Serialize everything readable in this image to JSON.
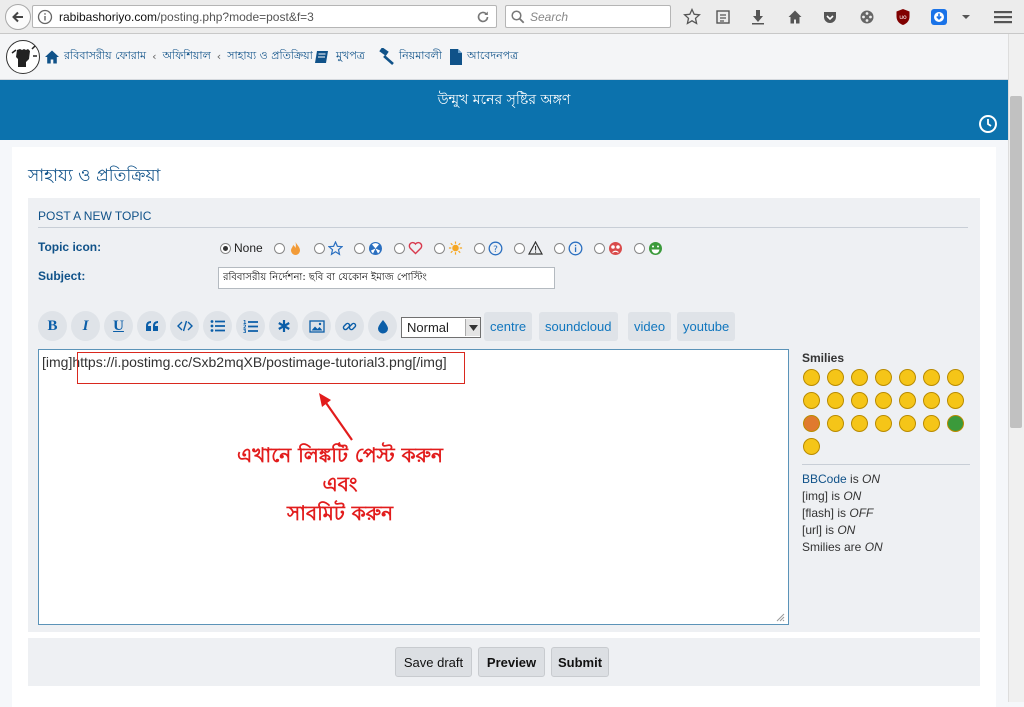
{
  "browser": {
    "url_prefix": "rabibashoriyo.com",
    "url_rest": "/posting.php?mode=post&f=3",
    "search_placeholder": "Search"
  },
  "nav": {
    "crumbs": [
      "রবিবাসরীয় ফোরাম",
      "অফিশিয়াল",
      "সাহায্য ও প্রতিক্রিয়া"
    ],
    "crumb_separator": "‹",
    "links": [
      "মুখপত্র",
      "নিয়মাবলী",
      "আবেদনপত্র"
    ]
  },
  "banner": {
    "title": "উন্মুখ মনের সৃষ্টির অঙ্গণ",
    "background": "#0c72ad"
  },
  "page": {
    "title": "সাহায্য ও প্রতিক্রিয়া"
  },
  "form": {
    "heading": "POST A NEW TOPIC",
    "topic_icon_label": "Topic icon:",
    "none_label": "None",
    "topic_icons": [
      "fire-icon",
      "star-icon",
      "radioactive-icon",
      "heart-icon",
      "sun-icon",
      "question-icon",
      "warning-icon",
      "info-icon",
      "sad-face-icon",
      "grin-face-icon"
    ],
    "subject_label": "Subject:",
    "subject_value": "রবিবাসরীয় নির্দেশনা: ছবি বা যেকোন ইমাজ পোস্টিং",
    "toolbar": {
      "bold": "B",
      "italic": "I",
      "underline": "U",
      "font_size_value": "Normal",
      "custom_tags": [
        "centre",
        "soundcloud",
        "video",
        "youtube"
      ]
    },
    "message": {
      "tag_open": "[img]",
      "url": "https://i.postimg.cc/Sxb2mqXB/postimage-tutorial3.png",
      "tag_close": "[/img]"
    },
    "annotation": {
      "line1": "এখানে লিঙ্কটি পেস্ট করুন",
      "line2": "এবং",
      "line3": "সাবমিট করুন",
      "color": "#e21c1c"
    },
    "smilies_title": "Smilies",
    "status": {
      "bbcode_link": "BBCode",
      "bbcode_rest": " is ",
      "bbcode_state": "ON",
      "img": "[img] is ",
      "img_state": "ON",
      "flash": "[flash] is ",
      "flash_state": "OFF",
      "url": "[url] is ",
      "url_state": "ON",
      "smilies": "Smilies are ",
      "smilies_state": "ON"
    },
    "buttons": {
      "save_draft": "Save draft",
      "preview": "Preview",
      "submit": "Submit"
    }
  }
}
